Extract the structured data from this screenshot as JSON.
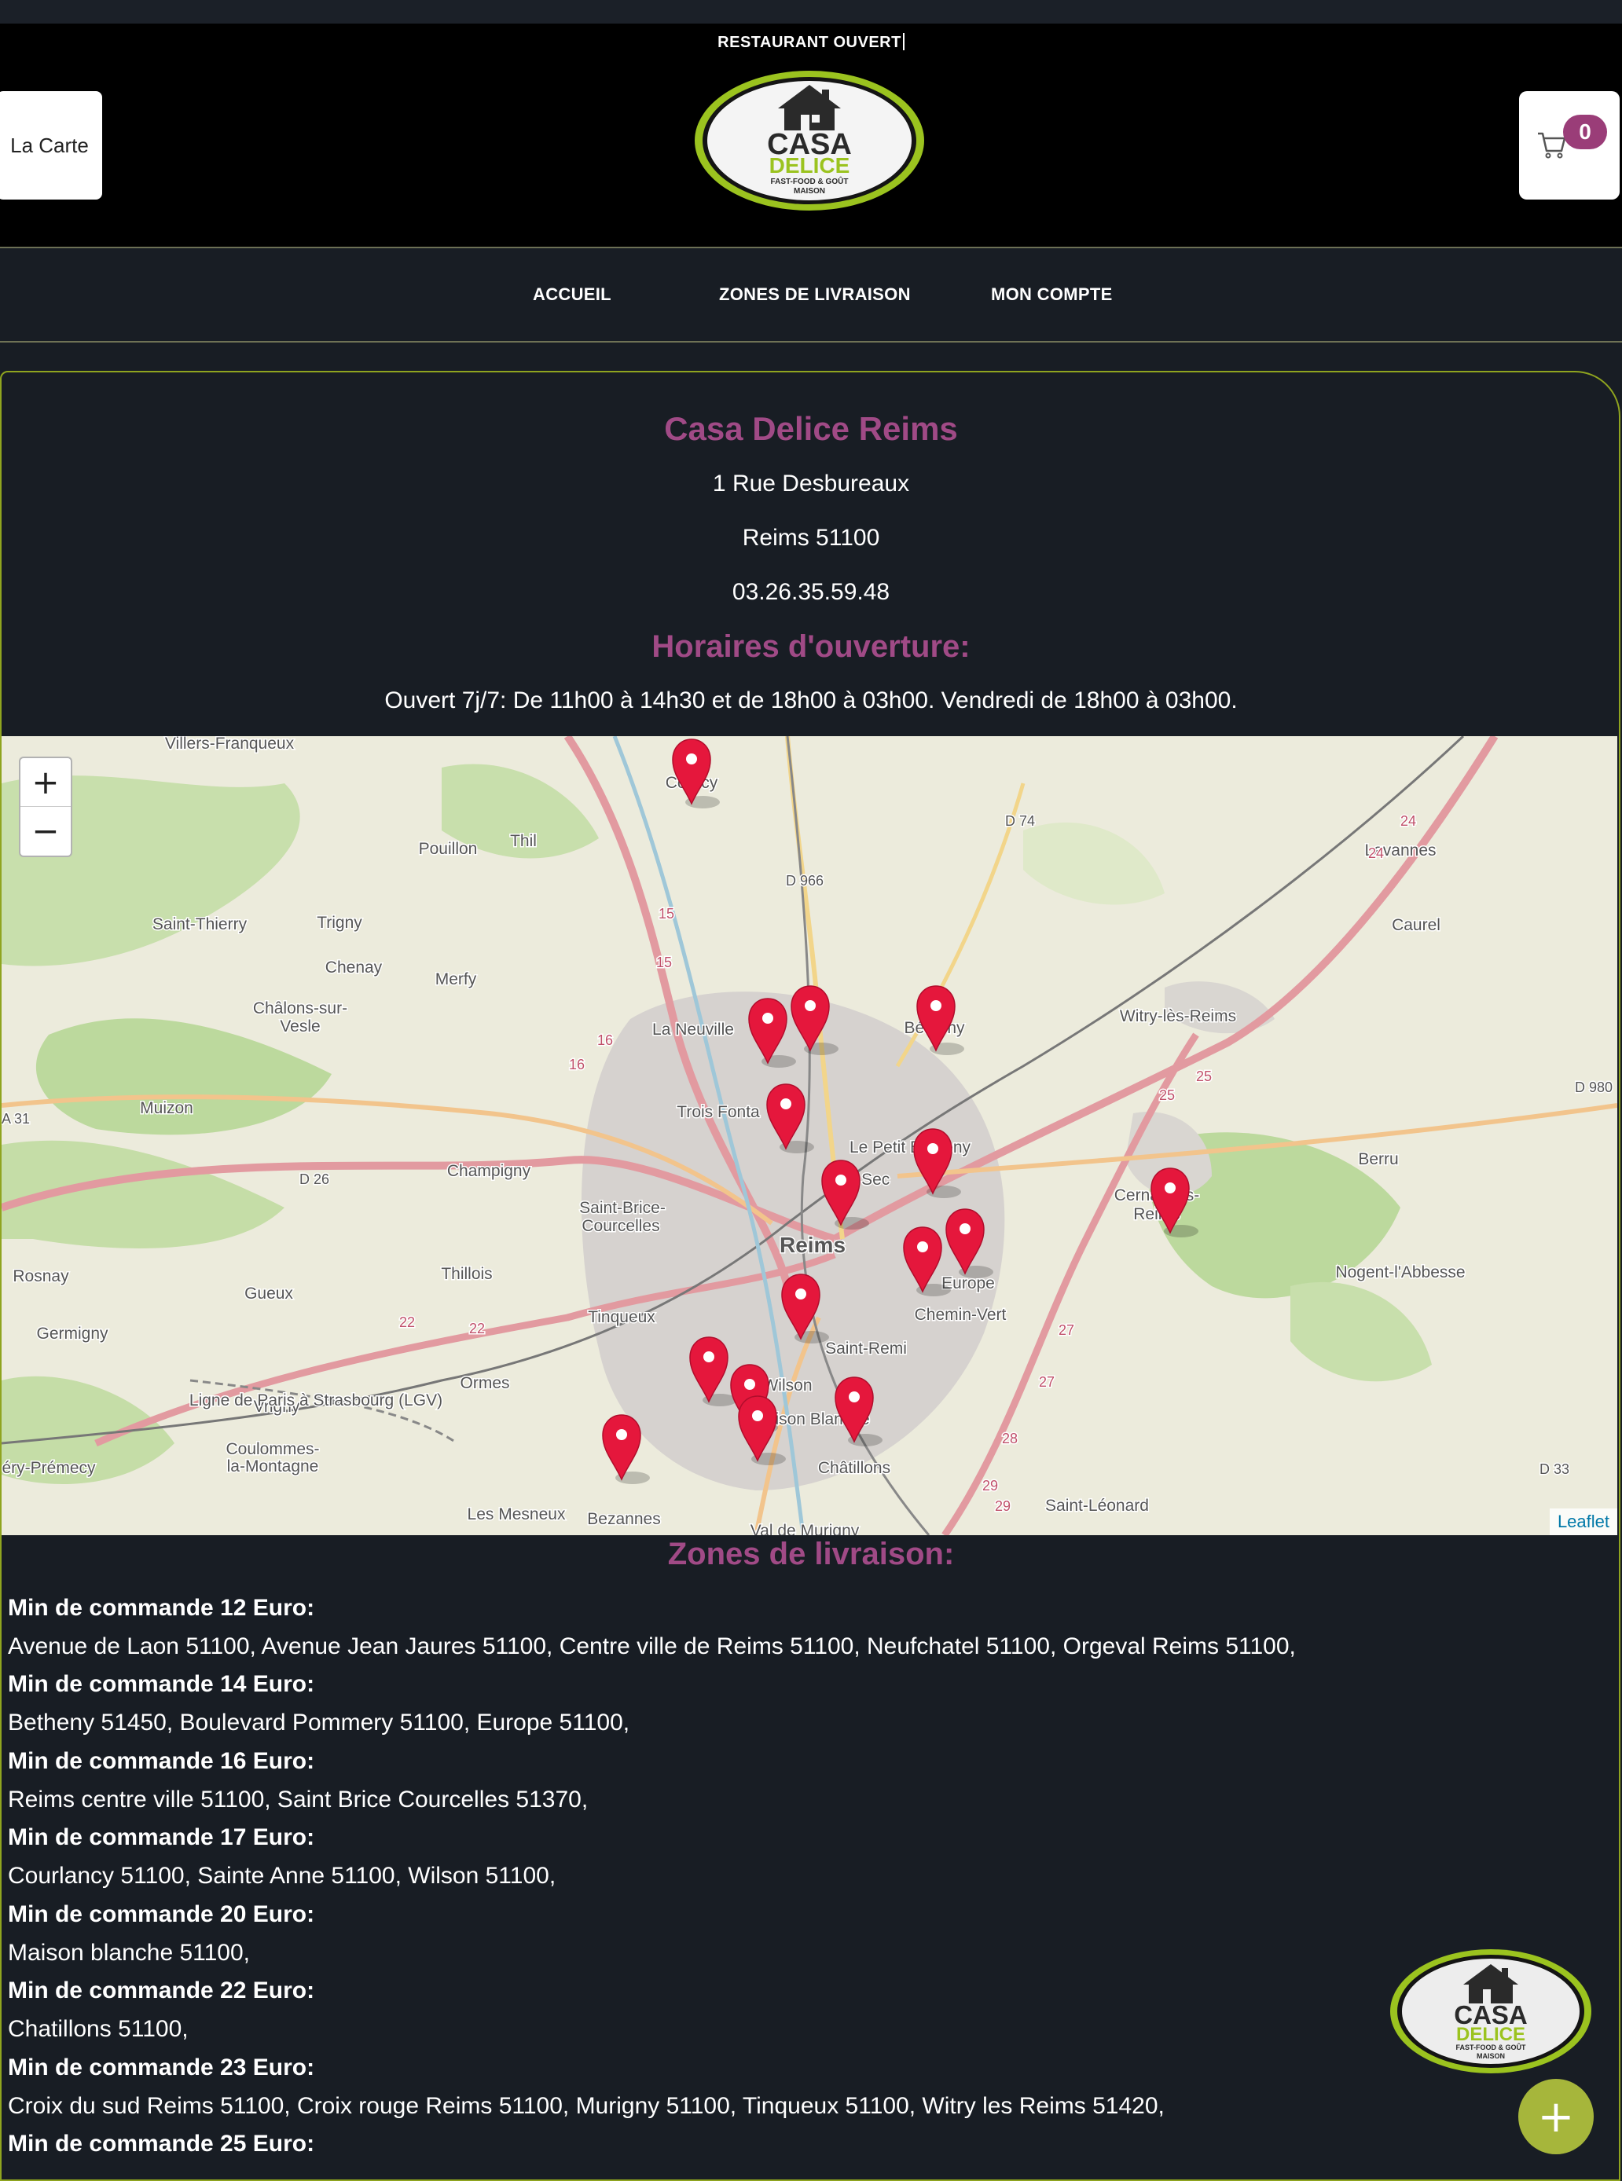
{
  "header": {
    "status": "RESTAURANT OUVERT",
    "carte_label": "La Carte",
    "cart_count": "0",
    "logo": {
      "line1": "CASA",
      "line2": "DELICE",
      "line3": "FAST-FOOD & GOÛT",
      "line4": "MAISON"
    }
  },
  "nav": {
    "items": [
      {
        "label": "ACCUEIL"
      },
      {
        "label": "ZONES DE LIVRAISON"
      },
      {
        "label": "MON COMPTE"
      }
    ]
  },
  "restaurant": {
    "name": "Casa Delice Reims",
    "street": "1 Rue Desbureaux",
    "city": "Reims 51100",
    "phone": "03.26.35.59.48",
    "hours_title": "Horaires d'ouverture:",
    "hours": "Ouvert 7j/7: De 11h00 à 14h30 et de 18h00 à 03h00.  Vendredi de 18h00 à 03h00."
  },
  "map": {
    "zoom_in": "+",
    "zoom_out": "−",
    "attribution": "Leaflet",
    "labels": [
      "Villers-Franqueux",
      "Courcy",
      "Pouillon",
      "Thil",
      "Saint-Thierry",
      "Trigny",
      "Chenay",
      "Merfy",
      "Châlons-sur-",
      "Vesle",
      "La Neuville",
      "Bétheny",
      "Witry-lès-Reims",
      "Lavannes",
      "Caurel",
      "Muizon",
      "Trois Fonta",
      "Le Petit Bétheny",
      "Port Sec",
      "Champigny",
      "Saint-Brice-",
      "Courcelles",
      "Reims",
      "Europe",
      "Chemin-Vert",
      "Cernay-lès-",
      "Reims",
      "Berru",
      "Nogent-l'Abbesse",
      "Rosnay",
      "Gueux",
      "Thillois",
      "Tinqueux",
      "Saint-Remi",
      "Germigny",
      "Ormes",
      "Wilson",
      "Vrigny",
      "Maison Blanche",
      "Châtillons",
      "Coulommes-",
      "la-Montagne",
      "éry-Prémecy",
      "Les Mesneux",
      "Bezannes",
      "Val de Murigny",
      "Saint-Léonard",
      "D 74",
      "D 966",
      "D 980",
      "D 26",
      "D 33",
      "A 31",
      "Ligne de Paris à Strasbourg (LGV)",
      "15",
      "15",
      "16",
      "16",
      "22",
      "22",
      "24",
      "24",
      "25",
      "25",
      "27",
      "27",
      "28",
      "29",
      "29"
    ]
  },
  "zones": {
    "title": "Zones de livraison:",
    "groups": [
      {
        "min": "Min de commande 12 Euro:",
        "list": "Avenue de Laon 51100, Avenue Jean Jaures 51100, Centre ville de Reims 51100, Neufchatel 51100, Orgeval Reims 51100,"
      },
      {
        "min": "Min de commande 14 Euro:",
        "list": "Betheny 51450, Boulevard Pommery 51100, Europe 51100,"
      },
      {
        "min": "Min de commande 16 Euro:",
        "list": "Reims centre ville 51100, Saint Brice Courcelles 51370,"
      },
      {
        "min": "Min de commande 17 Euro:",
        "list": "Courlancy 51100, Sainte Anne 51100, Wilson 51100,"
      },
      {
        "min": "Min de commande 20 Euro:",
        "list": "Maison blanche 51100,"
      },
      {
        "min": "Min de commande 22 Euro:",
        "list": "Chatillons 51100,"
      },
      {
        "min": "Min de commande 23 Euro:",
        "list": "Croix du sud Reims 51100, Croix rouge Reims 51100, Murigny 51100, Tinqueux 51100, Witry les Reims 51420,"
      },
      {
        "min": "Min de commande 25 Euro:",
        "list": ""
      }
    ]
  },
  "fab_label": "+"
}
